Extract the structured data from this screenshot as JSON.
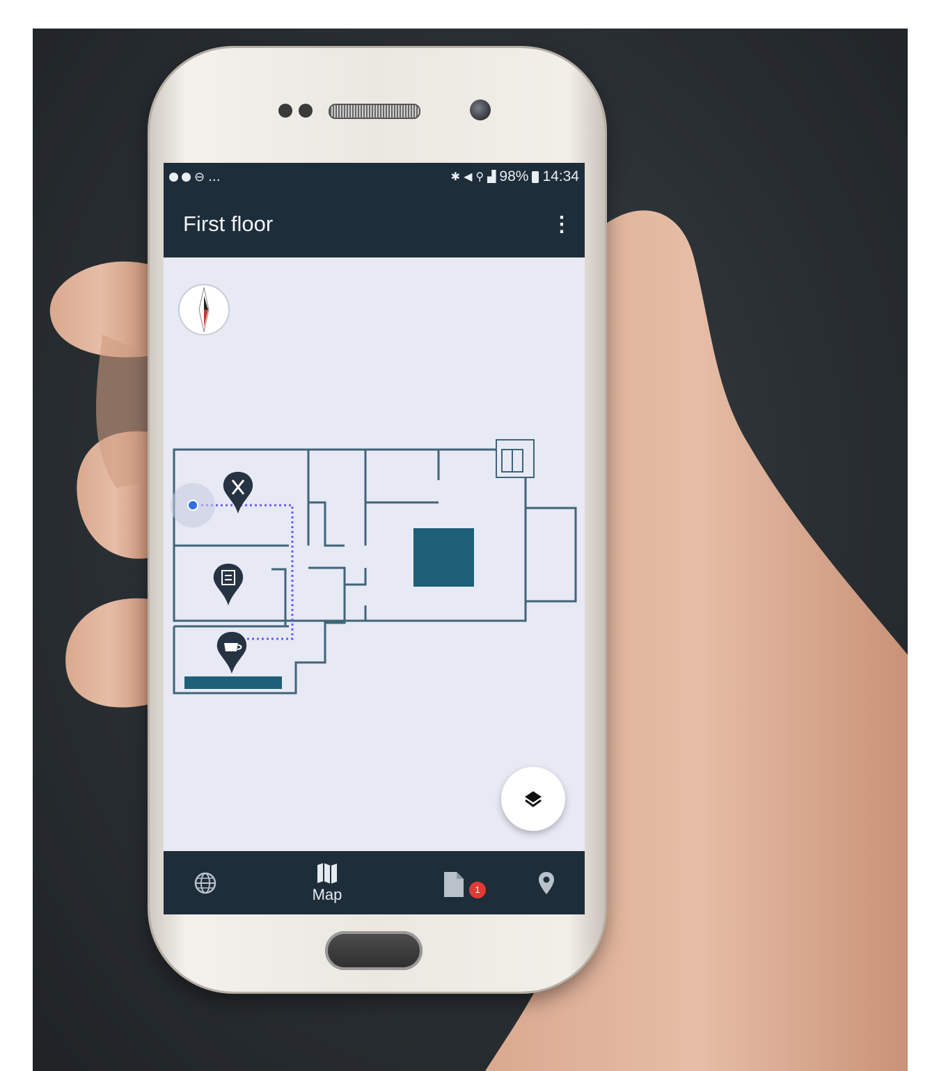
{
  "status_bar": {
    "left_icons": [
      "messenger-icon",
      "messenger-icon",
      "do-not-disturb-icon"
    ],
    "left_more": "...",
    "right_icons": [
      "bluetooth-icon",
      "mute-icon",
      "wifi-icon",
      "signal-icon"
    ],
    "battery_text": "98%",
    "battery_icon": "battery-icon",
    "time": "14:34"
  },
  "app_bar": {
    "title": "First floor",
    "menu_icon": "more-vert-icon"
  },
  "map": {
    "compass_icon": "compass-icon",
    "pois": [
      "restaurant-poi-icon",
      "book-poi-icon",
      "coffee-poi-icon"
    ],
    "user_location_icon": "user-location-icon",
    "elevator_icon": "elevator-icon",
    "route_color": "#6a5cff",
    "wall_color": "#3f6478",
    "block_color": "#1e5f78",
    "pin_color": "#263343"
  },
  "fab": {
    "layers_icon": "layers-icon"
  },
  "bottom_nav": {
    "items": [
      {
        "icon": "globe-icon"
      },
      {
        "icon": "map-icon",
        "label": "Map"
      },
      {
        "icon": "document-icon",
        "badge": "1"
      },
      {
        "icon": "location-pin-icon"
      }
    ]
  },
  "colors": {
    "app_bar": "#1e2d3a",
    "map_background": "#e7e9f4",
    "badge": "#e53935"
  }
}
